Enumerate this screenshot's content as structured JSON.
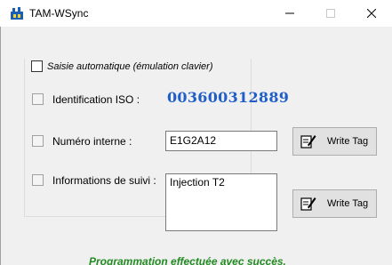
{
  "window": {
    "title": "TAM-WSync",
    "minimize_glyph": "—",
    "maximize_glyph": "☐",
    "close_glyph": "✕"
  },
  "form": {
    "auto_entry_label": "Saisie automatique (émulation clavier)",
    "iso_label": "Identification ISO :",
    "iso_value": "003600312889",
    "internal_label": "Numéro interne :",
    "internal_value": "E1G2A12",
    "tracking_label": "Informations de suivi :",
    "tracking_value": "Injection T2"
  },
  "buttons": {
    "write_tag_1": "Write Tag",
    "write_tag_2": "Write Tag"
  },
  "status": {
    "message": "Programmation effectuée avec succès.",
    "color": "#228b22"
  },
  "icons": {
    "app": "tam-logo-icon",
    "write": "write-tag-icon"
  }
}
